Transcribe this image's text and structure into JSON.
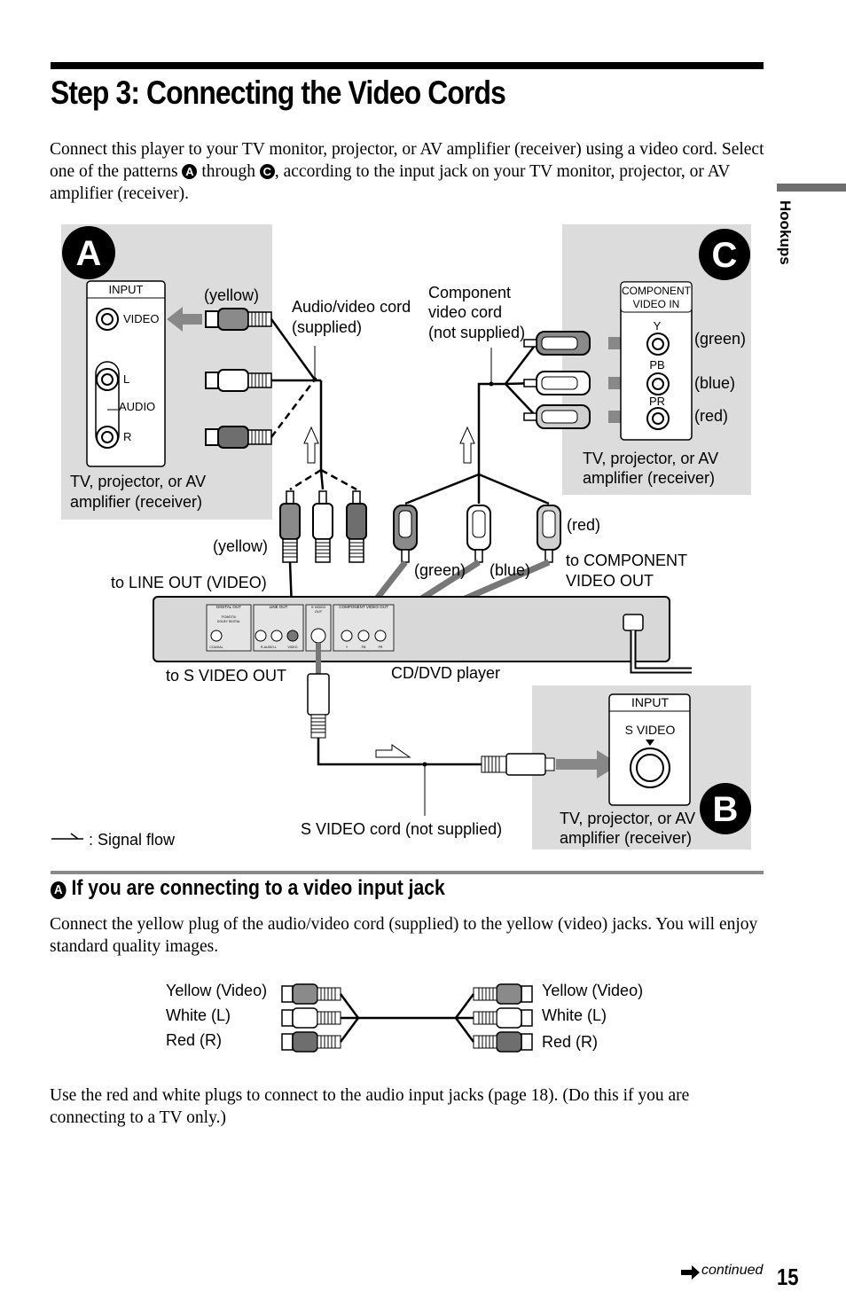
{
  "header": {
    "title": "Step 3: Connecting the Video Cords"
  },
  "side_tab": {
    "label": "Hookups"
  },
  "intro": {
    "text_1": "Connect this player to your TV monitor, projector, or AV amplifier (receiver) using a video cord. Select one of the patterns ",
    "badge_a": "A",
    "text_2": " through ",
    "badge_c": "C",
    "text_3": ", according to the input jack on your TV monitor, projector, or AV amplifier (receiver)."
  },
  "diagram": {
    "panel_a": {
      "letter": "A",
      "input_box": {
        "title": "INPUT",
        "video": "VIDEO",
        "l": "L",
        "audio": "AUDIO",
        "r": "R"
      },
      "device_line1": "TV, projector, or AV",
      "device_line2": "amplifier (receiver)"
    },
    "panel_b": {
      "letter": "B",
      "input_box": {
        "title": "INPUT",
        "svideo": "S VIDEO"
      },
      "device_line1": "TV, projector, or AV",
      "device_line2": "amplifier (receiver)"
    },
    "panel_c": {
      "letter": "C",
      "input_box": {
        "title_line1": "COMPONENT",
        "title_line2": "VIDEO IN",
        "y": "Y",
        "pb": "PB",
        "pr": "PR"
      },
      "green": "(green)",
      "blue": "(blue)",
      "red": "(red)",
      "device_line1": "TV, projector, or AV",
      "device_line2": "amplifier (receiver)"
    },
    "labels": {
      "yellow_top": "(yellow)",
      "av_cord_1": "Audio/video cord",
      "av_cord_2": "(supplied)",
      "comp_cord_1": "Component",
      "comp_cord_2": "video cord",
      "comp_cord_3": "(not supplied)",
      "yellow_bottom": "(yellow)",
      "to_line_out": "to LINE OUT (VIDEO)",
      "red_plug": "(red)",
      "green_plug": "(green)",
      "blue_plug": "(blue)",
      "to_comp_1": "to COMPONENT",
      "to_comp_2": "VIDEO OUT",
      "to_svideo_out": "to S VIDEO OUT",
      "player": "CD/DVD player",
      "svideo_cord": "S VIDEO cord (not supplied)",
      "signal_flow": ": Signal flow"
    },
    "player_panel": {
      "digital_out": "DIGITAL OUT",
      "pcm": "PCM/DTS/",
      "dolby": "DOLBY DIGITAL",
      "coaxial": "COAXIAL",
      "line_out": "LINE OUT",
      "r_audio_l": "R-AUDIO-L",
      "video": "VIDEO",
      "svideo_out_1": "S VIDEO",
      "svideo_out_2": "OUT",
      "component_out": "COMPONENT VIDEO OUT",
      "y": "Y",
      "pb": "PB",
      "pr": "PR"
    },
    "colors": {
      "panel": "#dcdcdc",
      "yellow_plug": "#8a8a8a",
      "red_plug": "#6e6e6e",
      "cord": "#000000",
      "arrow": "#888888"
    }
  },
  "section_a": {
    "badge": "A",
    "heading": "If you are connecting to a video input jack",
    "body": "Connect the yellow plug of the audio/video cord (supplied) to the yellow (video) jacks. You will enjoy standard quality images.",
    "cord_left": [
      "Yellow (Video)",
      "White (L)",
      "Red (R)"
    ],
    "cord_right": [
      "Yellow (Video)",
      "White (L)",
      "Red (R)"
    ],
    "note": "Use the red and white plugs to connect to the audio input jacks (page 18). (Do this if you are connecting to a TV only.)"
  },
  "footer": {
    "continued": "continued",
    "page_number": "15"
  }
}
